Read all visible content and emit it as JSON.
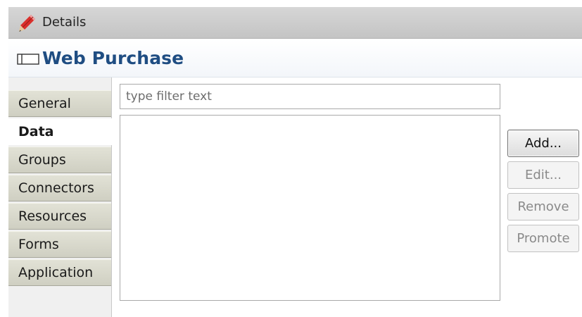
{
  "view_tab": {
    "title": "Details",
    "icon": "pencil-icon"
  },
  "form": {
    "title": "Web Purchase",
    "icon": "form-icon",
    "title_color": "#1f4d82"
  },
  "tabs": [
    {
      "label": "General",
      "selected": false
    },
    {
      "label": "Data",
      "selected": true
    },
    {
      "label": "Groups",
      "selected": false
    },
    {
      "label": "Connectors",
      "selected": false
    },
    {
      "label": "Resources",
      "selected": false
    },
    {
      "label": "Forms",
      "selected": false
    },
    {
      "label": "Application",
      "selected": false
    }
  ],
  "filter": {
    "placeholder": "type filter text",
    "value": ""
  },
  "list": {
    "items": []
  },
  "buttons": {
    "add": {
      "label": "Add...",
      "enabled": true
    },
    "edit": {
      "label": "Edit...",
      "enabled": false
    },
    "remove": {
      "label": "Remove",
      "enabled": false
    },
    "promote": {
      "label": "Promote",
      "enabled": false
    }
  }
}
